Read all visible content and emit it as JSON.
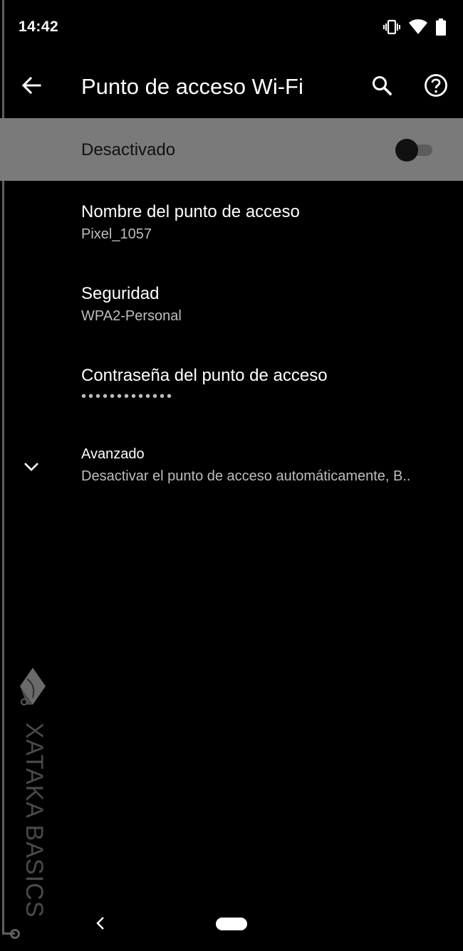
{
  "status_bar": {
    "time": "14:42",
    "icons": [
      "vibrate-icon",
      "wifi-icon",
      "battery-icon"
    ]
  },
  "app_bar": {
    "title": "Punto de acceso Wi-Fi",
    "icons": [
      "back-arrow-icon",
      "search-icon",
      "help-icon"
    ]
  },
  "master_switch": {
    "label": "Desactivado",
    "state": "off"
  },
  "preferences": {
    "name": {
      "title": "Nombre del punto de acceso",
      "summary": "Pixel_1057"
    },
    "security": {
      "title": "Seguridad",
      "summary": "WPA2-Personal"
    },
    "password": {
      "title": "Contraseña del punto de acceso",
      "summary": "•••••••••••••"
    },
    "advanced": {
      "title": "Avanzado",
      "summary": "Desactivar el punto de acceso automáticamente, B.."
    }
  },
  "watermark": {
    "text": "XATAKA BASICS"
  },
  "nav_bar": {
    "icons": [
      "nav-back-icon",
      "home-pill"
    ]
  },
  "colors": {
    "background": "#000000",
    "master_bar": "#7a7a7a",
    "summary_text": "#bdbdbd",
    "watermark": "#4a4a4a"
  }
}
